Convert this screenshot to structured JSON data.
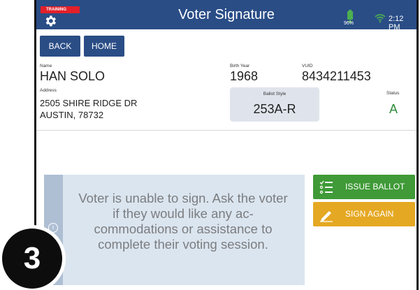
{
  "header": {
    "training_label": "TRAINING",
    "title": "Voter Signature",
    "battery": "96%",
    "time": "2:12 PM"
  },
  "nav": {
    "back": "BACK",
    "home": "HOME"
  },
  "voter": {
    "name_label": "Name",
    "name": "HAN SOLO",
    "address_label": "Address",
    "address_line1": "2505 SHIRE RIDGE DR",
    "address_line2": "AUSTIN, 78732",
    "birth_year_label": "Birth Year",
    "birth_year": "1968",
    "vuid_label": "VUID",
    "vuid": "8434211453",
    "ballot_style_label": "Ballot Style",
    "ballot_style": "253A-R",
    "status_label": "Status",
    "status": "A"
  },
  "message": {
    "text": "Voter is unable to sign. Ask the voter if they would like any ac-commodations or assistance to complete their voting session."
  },
  "actions": {
    "issue": "ISSUE BALLOT",
    "sign_again": "SIGN AGAIN"
  },
  "callout": {
    "number": "3"
  },
  "colors": {
    "header": "#2a4d86",
    "issue": "#3f9a37",
    "sign_again": "#e5a823",
    "status": "#2e8a3a",
    "training": "#e3202a"
  }
}
